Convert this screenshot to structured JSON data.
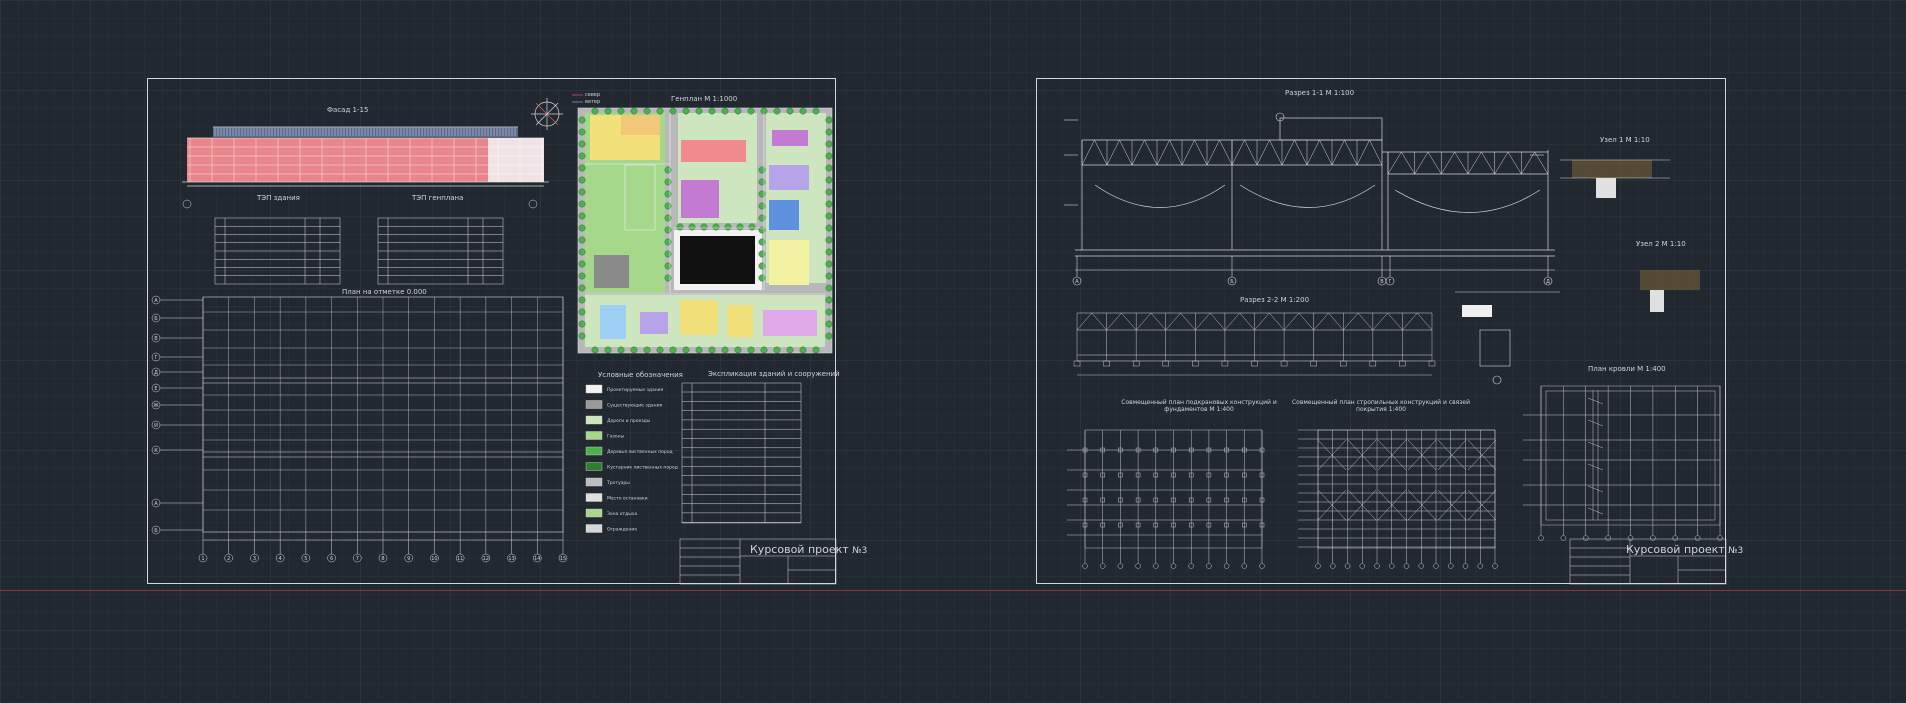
{
  "sheet1": {
    "facade_title": "Фасад 1-15",
    "genplan_title": "Генплан  М 1:1000",
    "legend_north": "север",
    "legend_wind": "ветер",
    "tep_building": "ТЭП здания",
    "tep_genplan": "ТЭП генплана",
    "plan_title": "План на отметке 0.000",
    "symbols_title": "Условные обозначения",
    "explication_title": "Экспликация зданий и сооружений",
    "stamp_title": "Курсовой проект",
    "stamp_number": "№3",
    "legend_items": [
      "Проектируемые здания",
      "Существующие здания",
      "Дороги и проезды",
      "Газоны",
      "Деревья лиственных пород",
      "Кустарник лиственных пород",
      "Тротуары",
      "Место остановки",
      "Зона отдыха",
      "Ограждение"
    ],
    "axis_numbers": [
      "1",
      "2",
      "3",
      "4",
      "5",
      "6",
      "7",
      "8",
      "9",
      "10",
      "11",
      "12",
      "13",
      "14",
      "15"
    ],
    "axis_letters": [
      "А",
      "Б",
      "В",
      "Г",
      "Д",
      "Е",
      "Ж",
      "И",
      "К"
    ]
  },
  "sheet2": {
    "section11_title": "Разрез 1-1  М 1:100",
    "section22_title": "Разрез 2-2  М 1:200",
    "node1_title": "Узел 1  М 1:10",
    "node2_title": "Узел 2  М 1:10",
    "roof_plan_title": "План кровли  М 1:400",
    "plan_a_title": "Совмещенный план подкрановых конструкций и фундаментов  М 1:400",
    "plan_b_title": "Совмещенный план стропильных конструкций и связей покрытия  1:400",
    "stamp_title": "Курсовой проект",
    "stamp_number": "№3",
    "axis_letters": [
      "А",
      "Б",
      "В",
      "Г",
      "Д"
    ]
  },
  "colors": {
    "background": "#212830",
    "line": "#d6d6d6",
    "accent_red": "#e9868b",
    "green": "#4caf50",
    "lightgreen": "#a5d88a",
    "axis_red": "#8a3434"
  }
}
